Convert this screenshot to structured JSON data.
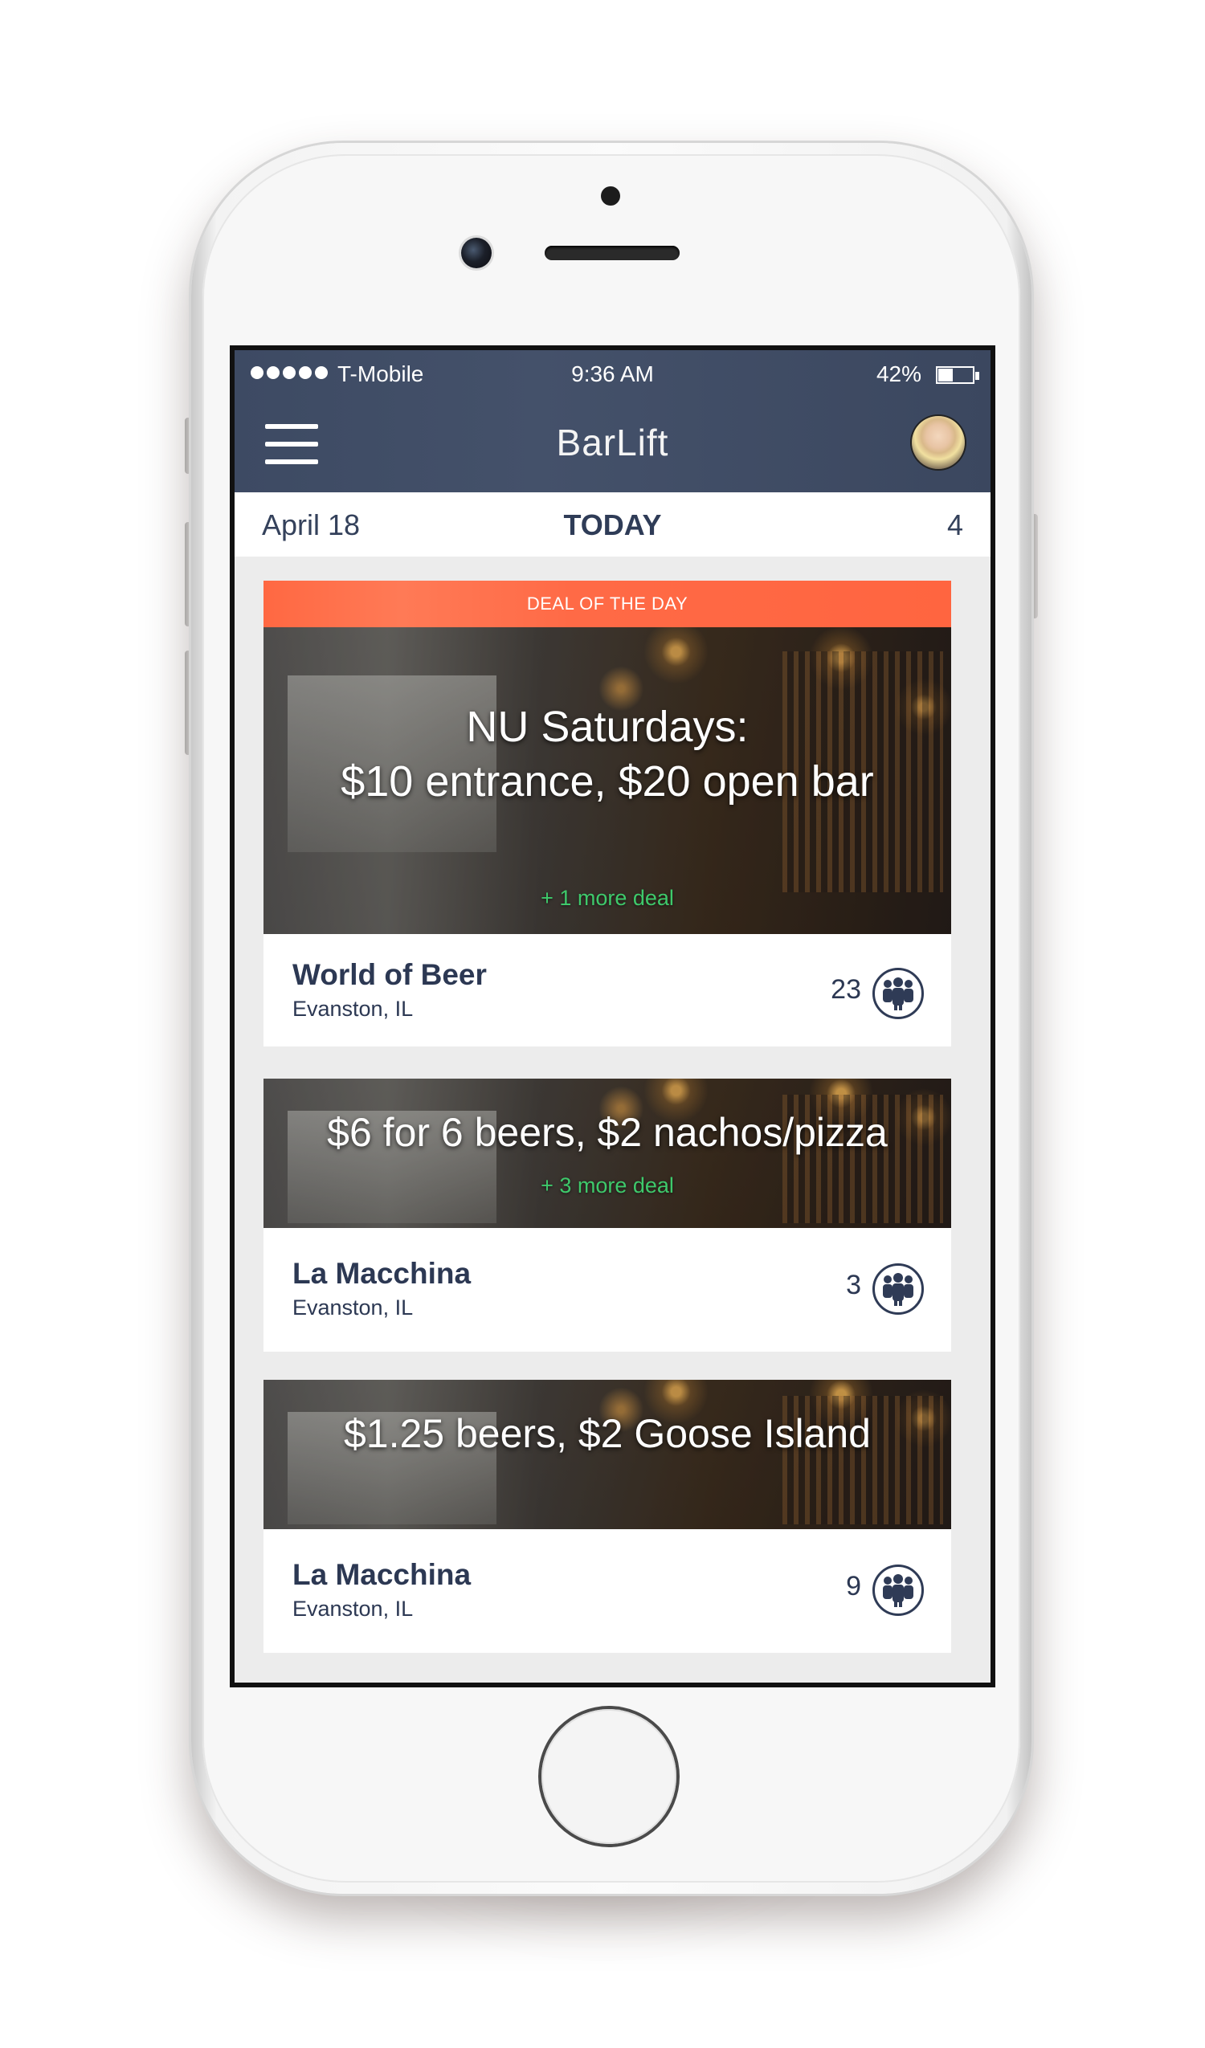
{
  "status_bar": {
    "carrier": "T-Mobile",
    "time": "9:36 AM",
    "battery": "42%",
    "battery_level": 0.42
  },
  "nav": {
    "title": "BarLift",
    "menu_icon": "hamburger-menu-icon",
    "avatar": "user-avatar"
  },
  "date_bar": {
    "date": "April 18",
    "label": "TODAY",
    "count": "4"
  },
  "cards": [
    {
      "banner": "DEAL OF THE DAY",
      "deal_line1": "NU Saturdays:",
      "deal_line2": "$10 entrance, $20 open bar",
      "more": "+ 1 more deal",
      "venue": "World of Beer",
      "location": "Evanston, IL",
      "count": "23"
    },
    {
      "deal": "$6 for 6 beers, $2 nachos/pizza",
      "more": "+ 3 more deal",
      "venue": "La Macchina",
      "location": "Evanston, IL",
      "count": "3"
    },
    {
      "deal": "$1.25 beers, $2 Goose Island",
      "venue": "La Macchina",
      "location": "Evanston, IL",
      "count": "9"
    }
  ],
  "colors": {
    "header": "#3d4a63",
    "accent": "#ff6842",
    "more_deal": "#3ec96b",
    "text_dark": "#2c3853"
  }
}
